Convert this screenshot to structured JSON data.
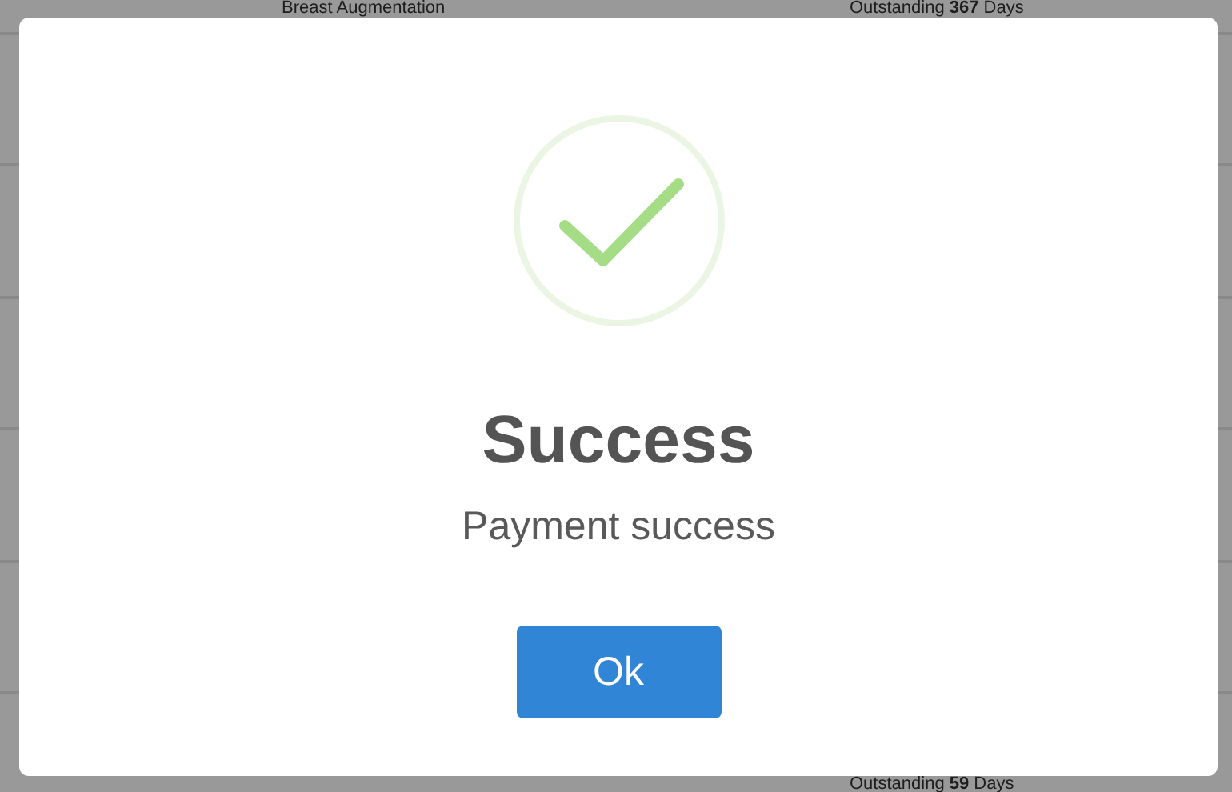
{
  "background": {
    "rows": [
      {
        "procedure": "Breast Augmentation",
        "outstanding": "Outstanding **367** Days"
      },
      {
        "outstanding": "Outstanding **59** Days"
      }
    ]
  },
  "dialog": {
    "kind": "success",
    "title": "Success",
    "text": "Payment success",
    "confirm_button": "Ok"
  }
}
